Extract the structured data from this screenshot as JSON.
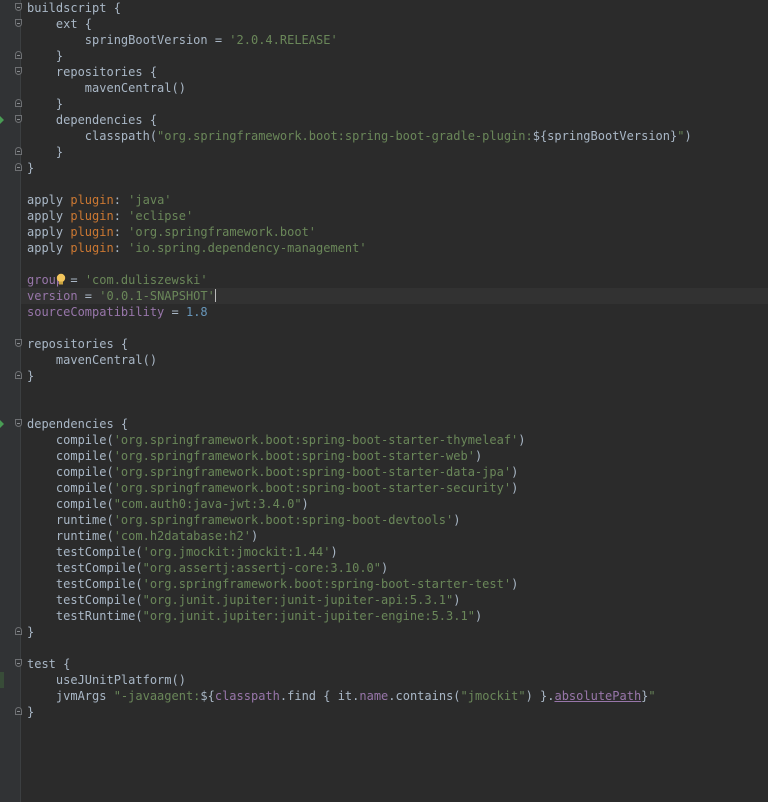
{
  "editor": {
    "lines": [
      [
        {
          "t": "buildscript {"
        }
      ],
      [
        {
          "t": "    ext {"
        }
      ],
      [
        {
          "t": "        springBootVersion = "
        },
        {
          "t": "'2.0.4.RELEASE'",
          "c": "str"
        }
      ],
      [
        {
          "t": "    }"
        }
      ],
      [
        {
          "t": "    repositories {"
        }
      ],
      [
        {
          "t": "        mavenCentral()"
        }
      ],
      [
        {
          "t": "    }"
        }
      ],
      [
        {
          "t": "    dependencies {"
        }
      ],
      [
        {
          "t": "        classpath("
        },
        {
          "t": "\"org.springframework.boot:spring-boot-gradle-plugin:",
          "c": "str"
        },
        {
          "t": "${springBootVersion}"
        },
        {
          "t": "\"",
          "c": "str"
        },
        {
          "t": ")"
        }
      ],
      [
        {
          "t": "    }"
        }
      ],
      [
        {
          "t": "}"
        }
      ],
      [],
      [
        {
          "t": "apply "
        },
        {
          "t": "plugin",
          "c": "kw"
        },
        {
          "t": ": "
        },
        {
          "t": "'java'",
          "c": "str"
        }
      ],
      [
        {
          "t": "apply "
        },
        {
          "t": "plugin",
          "c": "kw"
        },
        {
          "t": ": "
        },
        {
          "t": "'eclipse'",
          "c": "str"
        }
      ],
      [
        {
          "t": "apply "
        },
        {
          "t": "plugin",
          "c": "kw"
        },
        {
          "t": ": "
        },
        {
          "t": "'org.springframework.boot'",
          "c": "str"
        }
      ],
      [
        {
          "t": "apply "
        },
        {
          "t": "plugin",
          "c": "kw"
        },
        {
          "t": ": "
        },
        {
          "t": "'io.spring.dependency-management'",
          "c": "str"
        }
      ],
      [],
      [
        {
          "t": "group",
          "c": "prop"
        },
        {
          "t": " = "
        },
        {
          "t": "'com.duliszewski'",
          "c": "str"
        }
      ],
      [
        {
          "t": "version",
          "c": "prop"
        },
        {
          "t": " = "
        },
        {
          "t": "'0.0.1-SNAPSHOT'",
          "c": "str"
        }
      ],
      [
        {
          "t": "sourceCompatibility",
          "c": "prop"
        },
        {
          "t": " = "
        },
        {
          "t": "1.8",
          "c": "num"
        }
      ],
      [],
      [
        {
          "t": "repositories {"
        }
      ],
      [
        {
          "t": "    mavenCentral()"
        }
      ],
      [
        {
          "t": "}"
        }
      ],
      [],
      [],
      [
        {
          "t": "dependencies {"
        }
      ],
      [
        {
          "t": "    compile("
        },
        {
          "t": "'org.springframework.boot:spring-boot-starter-thymeleaf'",
          "c": "str"
        },
        {
          "t": ")"
        }
      ],
      [
        {
          "t": "    compile("
        },
        {
          "t": "'org.springframework.boot:spring-boot-starter-web'",
          "c": "str"
        },
        {
          "t": ")"
        }
      ],
      [
        {
          "t": "    compile("
        },
        {
          "t": "'org.springframework.boot:spring-boot-starter-data-jpa'",
          "c": "str"
        },
        {
          "t": ")"
        }
      ],
      [
        {
          "t": "    compile("
        },
        {
          "t": "'org.springframework.boot:spring-boot-starter-security'",
          "c": "str"
        },
        {
          "t": ")"
        }
      ],
      [
        {
          "t": "    compile("
        },
        {
          "t": "\"com.auth0:java-jwt:3.4.0\"",
          "c": "str"
        },
        {
          "t": ")"
        }
      ],
      [
        {
          "t": "    runtime("
        },
        {
          "t": "'org.springframework.boot:spring-boot-devtools'",
          "c": "str"
        },
        {
          "t": ")"
        }
      ],
      [
        {
          "t": "    runtime("
        },
        {
          "t": "'com.h2database:h2'",
          "c": "str"
        },
        {
          "t": ")"
        }
      ],
      [
        {
          "t": "    testCompile("
        },
        {
          "t": "'org.jmockit:jmockit:1.44'",
          "c": "str"
        },
        {
          "t": ")"
        }
      ],
      [
        {
          "t": "    testCompile("
        },
        {
          "t": "\"org.assertj:assertj-core:3.10.0\"",
          "c": "str"
        },
        {
          "t": ")"
        }
      ],
      [
        {
          "t": "    testCompile("
        },
        {
          "t": "'org.springframework.boot:spring-boot-starter-test'",
          "c": "str"
        },
        {
          "t": ")"
        }
      ],
      [
        {
          "t": "    testCompile("
        },
        {
          "t": "\"org.junit.jupiter:junit-jupiter-api:5.3.1\"",
          "c": "str"
        },
        {
          "t": ")"
        }
      ],
      [
        {
          "t": "    testRuntime("
        },
        {
          "t": "\"org.junit.jupiter:junit-jupiter-engine:5.3.1\"",
          "c": "str"
        },
        {
          "t": ")"
        }
      ],
      [
        {
          "t": "}"
        }
      ],
      [],
      [
        {
          "t": "test {"
        }
      ],
      [
        {
          "t": "    useJUnitPlatform()"
        }
      ],
      [
        {
          "t": "    jvmArgs "
        },
        {
          "t": "\"-javaagent:",
          "c": "str"
        },
        {
          "t": "${"
        },
        {
          "t": "classpath",
          "c": "prop"
        },
        {
          "t": ".find { it."
        },
        {
          "t": "name",
          "c": "prop"
        },
        {
          "t": ".contains("
        },
        {
          "t": "\"jmockit\"",
          "c": "str"
        },
        {
          "t": ") }."
        },
        {
          "t": "absolutePath",
          "c": "prop ul"
        },
        {
          "t": "}"
        },
        {
          "t": "\"",
          "c": "str"
        }
      ],
      [
        {
          "t": "}"
        }
      ]
    ],
    "fold_open_lines": [
      0,
      1,
      4,
      7,
      21,
      26,
      41
    ],
    "fold_close_lines": [
      3,
      6,
      9,
      10,
      23,
      39,
      44
    ],
    "run_arrow_lines": [
      7,
      26
    ],
    "changed_lines": [
      42
    ],
    "current_line": 18,
    "caret_line": 18,
    "intention_bulb_line": 17
  }
}
